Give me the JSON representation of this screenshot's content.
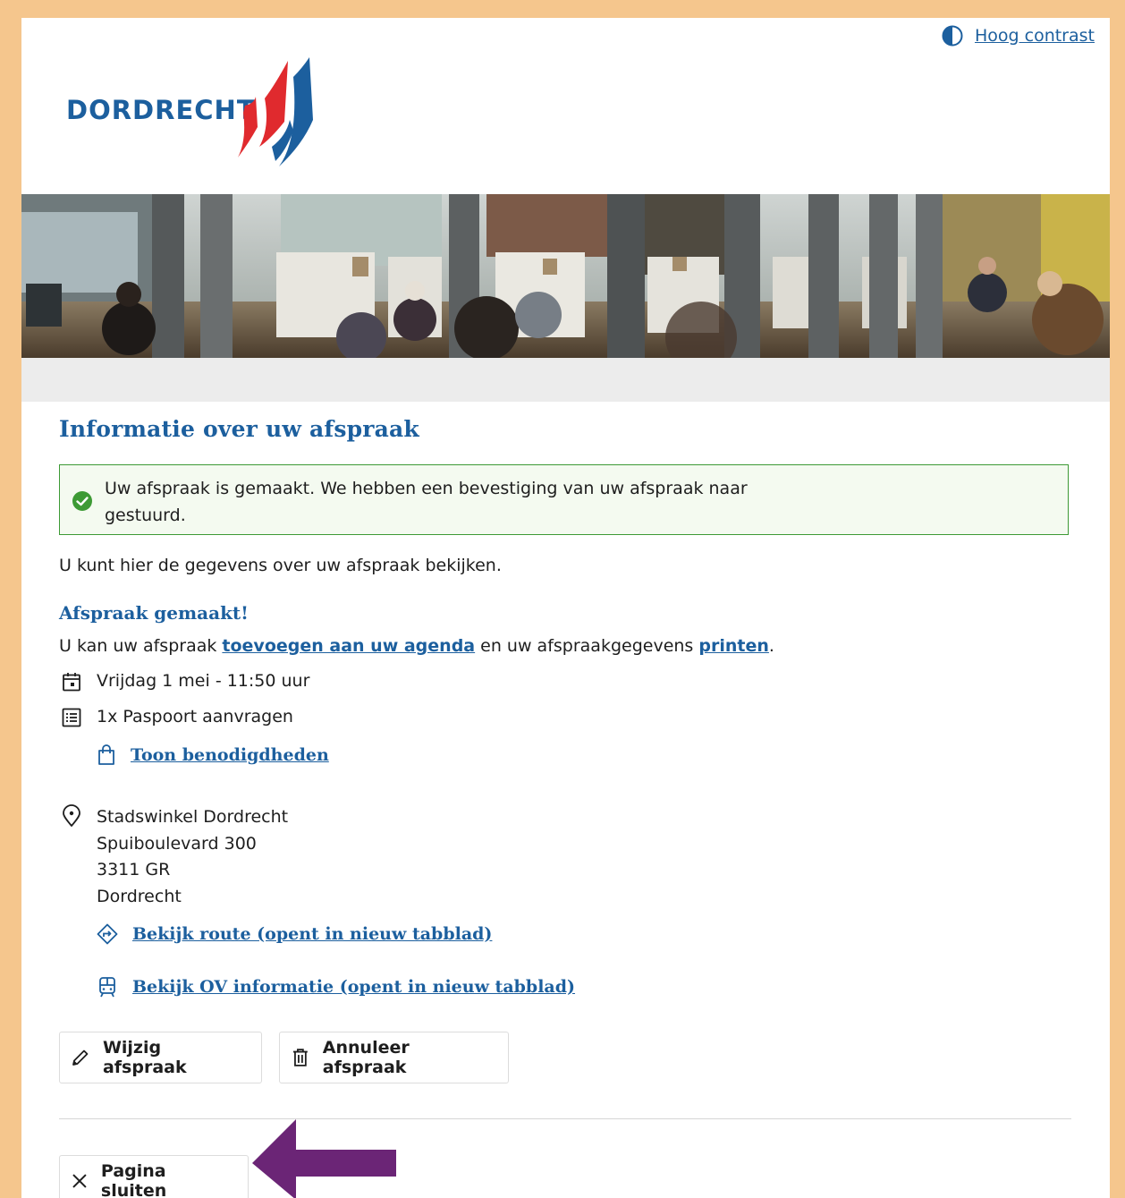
{
  "header": {
    "contrast_label": "Hoog contrast",
    "logo_text": "DORDRECHT"
  },
  "page": {
    "title": "Informatie over uw afspraak",
    "alert": "Uw afspraak is gemaakt. We hebben een bevestiging van uw afspraak naar gestuurd.",
    "intro": "U kunt hier de gegevens over uw afspraak bekijken."
  },
  "appointment": {
    "heading": "Afspraak gemaakt!",
    "agenda_prefix": "U kan uw afspraak ",
    "agenda_link": "toevoegen aan uw agenda",
    "agenda_middle": " en uw afspraakgegevens ",
    "print_link": "printen",
    "agenda_suffix": ".",
    "datetime": "Vrijdag 1 mei - 11:50 uur",
    "product": "1x Paspoort aanvragen",
    "requirements_link": "Toon benodigdheden",
    "location": {
      "name": "Stadswinkel Dordrecht",
      "street": "Spuiboulevard 300",
      "postcode": "3311 GR",
      "city": "Dordrecht"
    },
    "route_link": "Bekijk route (opent in nieuw tabblad)",
    "ov_link": "Bekijk OV informatie (opent in nieuw tabblad)"
  },
  "actions": {
    "edit": "Wijzig afspraak",
    "cancel": "Annuleer afspraak",
    "close": "Pagina sluiten"
  },
  "colors": {
    "brand_blue": "#1c5f9e",
    "success_green": "#3d9a35",
    "annotation_arrow": "#6b2576",
    "border_orange": "#f5c68d"
  }
}
